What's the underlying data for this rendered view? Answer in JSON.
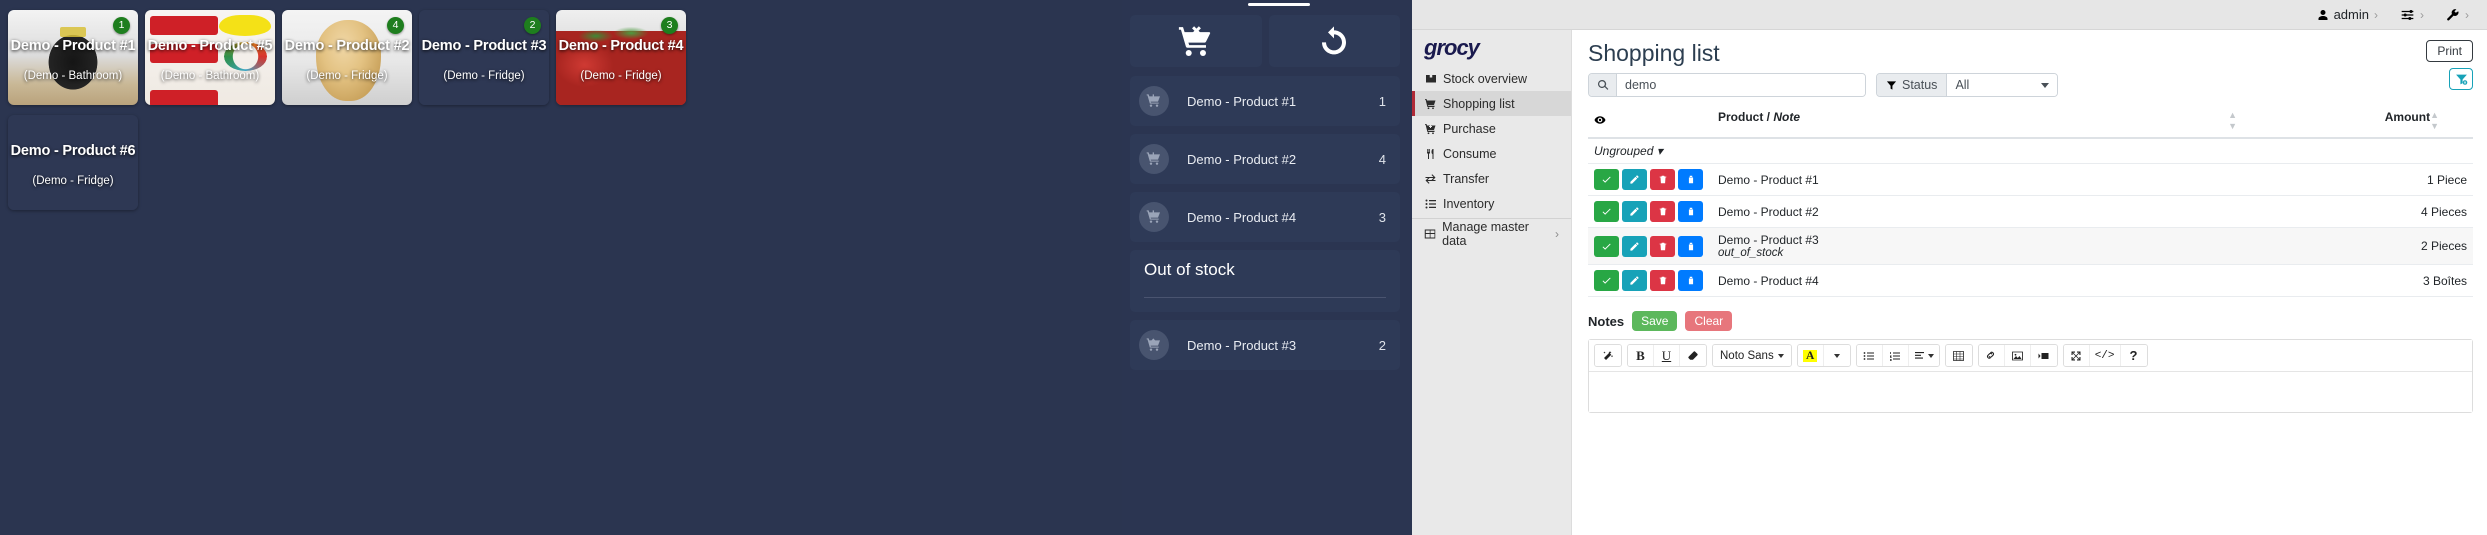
{
  "board": {
    "cards": [
      {
        "name": "Demo - Product #1",
        "location": "(Demo - Bathroom)",
        "badge": "1",
        "photo": "axe-deodorant-photo"
      },
      {
        "name": "Demo - Product #5",
        "location": "(Demo - Bathroom)",
        "badge": "",
        "photo": "colgate-toothpaste-photo"
      },
      {
        "name": "Demo - Product #2",
        "location": "(Demo - Fridge)",
        "badge": "4",
        "photo": "onion-photo"
      },
      {
        "name": "Demo - Product #3",
        "location": "(Demo - Fridge)",
        "badge": "2",
        "photo": "none"
      },
      {
        "name": "Demo - Product #4",
        "location": "(Demo - Fridge)",
        "badge": "3",
        "photo": "strawberries-photo"
      },
      {
        "name": "Demo - Product #6",
        "location": "(Demo - Fridge)",
        "badge": "",
        "photo": "none"
      }
    ]
  },
  "cart_panel": {
    "actions": [
      {
        "icon": "cart-remove-icon",
        "label": ""
      },
      {
        "icon": "refresh-icon",
        "label": ""
      }
    ],
    "items": [
      {
        "type": "item",
        "icon": "cart-arrow-down-icon",
        "name": "Demo - Product #1",
        "qty": "1"
      },
      {
        "type": "item",
        "icon": "cart-arrow-down-icon",
        "name": "Demo - Product #2",
        "qty": "4"
      },
      {
        "type": "item",
        "icon": "cart-arrow-down-icon",
        "name": "Demo - Product #4",
        "qty": "3"
      },
      {
        "type": "section",
        "title": "Out of stock"
      },
      {
        "type": "item",
        "icon": "cart-arrow-up-icon",
        "name": "Demo - Product #3",
        "qty": "2"
      }
    ]
  },
  "grocy": {
    "topbar": {
      "user": "admin",
      "icons": [
        "user-icon",
        "sliders-icon",
        "wrench-icon"
      ],
      "chevron": "›"
    },
    "logo": "grocy",
    "sidebar": {
      "items": [
        {
          "label": "Stock overview",
          "icon": "box-icon",
          "active": false
        },
        {
          "label": "Shopping list",
          "icon": "cart-icon",
          "active": true
        },
        {
          "label": "Purchase",
          "icon": "cart-plus-icon",
          "active": false
        },
        {
          "label": "Consume",
          "icon": "utensils-icon",
          "active": false
        },
        {
          "label": "Transfer",
          "icon": "exchange-icon",
          "active": false
        },
        {
          "label": "Inventory",
          "icon": "list-icon",
          "active": false
        },
        {
          "label": "Manage master data",
          "icon": "table-icon",
          "active": false,
          "chevron": "›"
        }
      ]
    },
    "page_title": "Shopping list",
    "print_label": "Print",
    "filter_clear_icon": "filter-clear-icon",
    "search": {
      "value": "demo",
      "placeholder": "",
      "icon": "search-icon"
    },
    "status_filter": {
      "label": "Status",
      "value": "All",
      "icon": "filter-icon"
    },
    "table": {
      "headers": {
        "eye": "eye-icon",
        "product": "Product / ",
        "product_note": "Note",
        "amount": "Amount"
      },
      "group_label": "Ungrouped",
      "row_buttons": [
        {
          "icon": "check-icon",
          "color": "green"
        },
        {
          "icon": "edit-icon",
          "color": "teal"
        },
        {
          "icon": "trash-icon",
          "color": "red"
        },
        {
          "icon": "product-icon",
          "color": "blue"
        }
      ],
      "rows": [
        {
          "product": "Demo - Product #1",
          "note": "",
          "amount": "1 Piece"
        },
        {
          "product": "Demo - Product #2",
          "note": "",
          "amount": "4 Pieces"
        },
        {
          "product": "Demo - Product #3",
          "note": "out_of_stock",
          "amount": "2 Pieces"
        },
        {
          "product": "Demo - Product #4",
          "note": "",
          "amount": "3 Boîtes"
        }
      ]
    },
    "notes": {
      "label": "Notes",
      "save_label": "Save",
      "clear_label": "Clear",
      "editor_font": "Noto Sans",
      "toolbar_icons": [
        "magic-wand-icon",
        "bold-icon",
        "underline-icon",
        "eraser-icon",
        "font-name-dropdown",
        "text-color-icon",
        "text-color-dropdown",
        "unordered-list-icon",
        "ordered-list-icon",
        "paragraph-align-icon",
        "table-icon",
        "link-icon",
        "image-icon",
        "video-icon",
        "fullscreen-icon",
        "code-view-icon",
        "help-icon"
      ]
    }
  },
  "colors": {
    "board_bg": "#2b3551",
    "card_bg": "#2e3854",
    "badge_green": "#1e7e1e",
    "accent_red": "#b02a37",
    "btn_green": "#28a745",
    "btn_teal": "#17a2b8",
    "btn_red": "#dc3545",
    "btn_blue": "#007bff"
  }
}
